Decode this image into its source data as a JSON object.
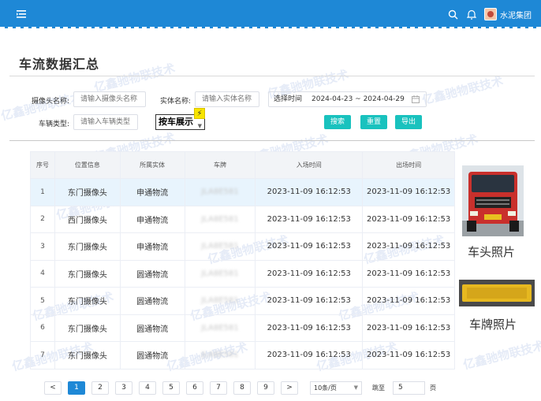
{
  "header": {
    "org_name": "水泥集团",
    "colors": {
      "bar": "#1e88d6"
    }
  },
  "page_title": "车流数据汇总",
  "filters": {
    "camera_label": "摄像头名称:",
    "camera_placeholder": "请输入摄像头名称",
    "entity_label": "实体名称:",
    "entity_placeholder": "请输入实体名称",
    "date_label": "选择时间",
    "date_range": "2024-04-23 ~ 2024-04-29",
    "vehicle_type_label": "车辆类型:",
    "vehicle_type_placeholder": "请输入车辆类型",
    "view_mode": "按车展示"
  },
  "buttons": {
    "search": "搜索",
    "reset": "重置",
    "export": "导出"
  },
  "table": {
    "headers": [
      "序号",
      "位置信息",
      "所属实体",
      "车牌",
      "入场时间",
      "出场时间"
    ],
    "rows": [
      {
        "idx": "1",
        "location": "东门摄像头",
        "entity": "申通物流",
        "plate": "JLA8E581",
        "in": "2023-11-09 16:12:53",
        "out": "2023-11-09 16:12:53"
      },
      {
        "idx": "2",
        "location": "西门摄像头",
        "entity": "申通物流",
        "plate": "JLA8E581",
        "in": "2023-11-09 16:12:53",
        "out": "2023-11-09 16:12:53"
      },
      {
        "idx": "3",
        "location": "东门摄像头",
        "entity": "申通物流",
        "plate": "JLA8E581",
        "in": "2023-11-09 16:12:53",
        "out": "2023-11-09 16:12:53"
      },
      {
        "idx": "4",
        "location": "东门摄像头",
        "entity": "圆通物流",
        "plate": "JLA8E581",
        "in": "2023-11-09 16:12:53",
        "out": "2023-11-09 16:12:53"
      },
      {
        "idx": "5",
        "location": "东门摄像头",
        "entity": "圆通物流",
        "plate": "JLA8E581",
        "in": "2023-11-09 16:12:53",
        "out": "2023-11-09 16:12:53"
      },
      {
        "idx": "6",
        "location": "东门摄像头",
        "entity": "圆通物流",
        "plate": "JLA8E581",
        "in": "2023-11-09 16:12:53",
        "out": "2023-11-09 16:12:53"
      },
      {
        "idx": "7",
        "location": "东门摄像头",
        "entity": "圆通物流",
        "plate": "JLA8E581",
        "in": "2023-11-09 16:12:53",
        "out": "2023-11-09 16:12:53"
      }
    ]
  },
  "photos": {
    "head_caption": "车头照片",
    "plate_caption": "车牌照片"
  },
  "pagination": {
    "prev": "<",
    "next": ">",
    "pages": [
      "1",
      "2",
      "3",
      "4",
      "5",
      "6",
      "7",
      "8",
      "9"
    ],
    "active": "1",
    "page_size": "10条/页",
    "goto_label": "跳至",
    "goto_value": "5",
    "page_unit": "页"
  },
  "watermark": {
    "text": "亿鑫驰物联技术"
  }
}
